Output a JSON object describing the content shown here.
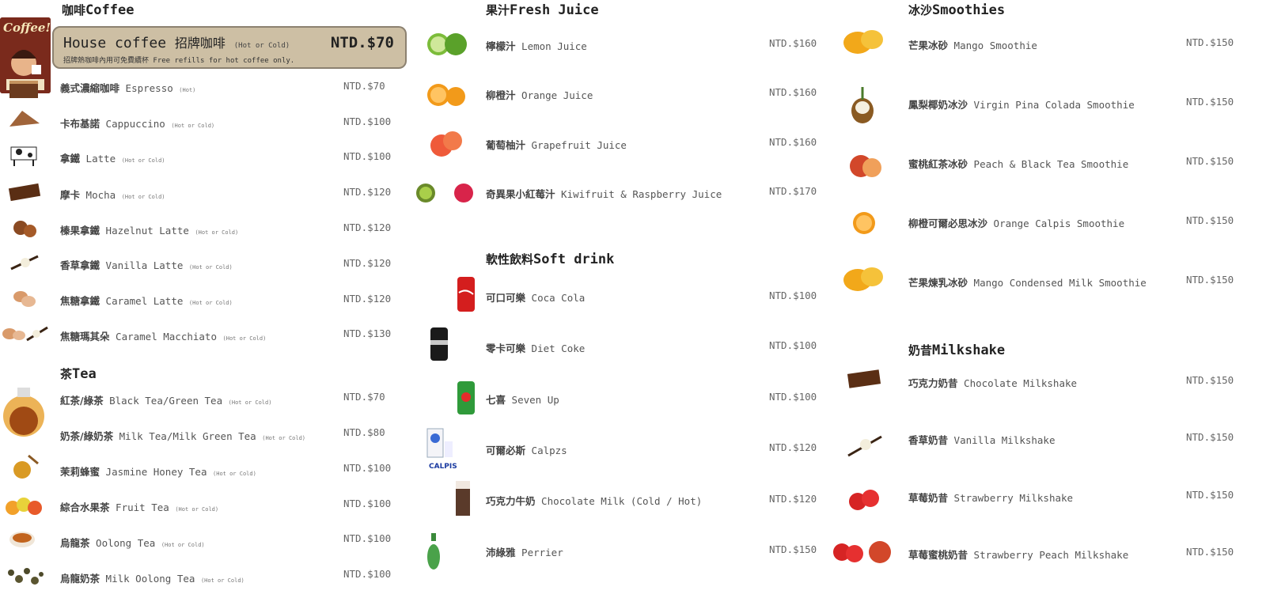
{
  "coffee": {
    "title_zh": "咖啡",
    "title_en": "Coffee",
    "house": {
      "name_en": "House coffee",
      "name_zh": "招牌咖啡",
      "note": "(Hot or Cold)",
      "price": "NTD.$70",
      "refill": "招牌熱咖啡內用可免費續杯 Free refills for hot coffee only."
    },
    "items": [
      {
        "zh": "義式濃縮咖啡",
        "en": "Espresso",
        "note": "(Hot)",
        "price": "NTD.$70"
      },
      {
        "zh": "卡布基諾",
        "en": "Cappuccino",
        "note": "(Hot or Cold)",
        "price": "NTD.$100"
      },
      {
        "zh": "拿鐵",
        "en": "Latte",
        "note": "(Hot or Cold)",
        "price": "NTD.$100"
      },
      {
        "zh": "摩卡",
        "en": "Mocha",
        "note": "(Hot or Cold)",
        "price": "NTD.$120"
      },
      {
        "zh": "榛果拿鐵",
        "en": " Hazelnut Latte",
        "note": "(Hot or Cold)",
        "price": "NTD.$120"
      },
      {
        "zh": "香草拿鐵",
        "en": "Vanilla Latte",
        "note": "(Hot or Cold)",
        "price": "NTD.$120"
      },
      {
        "zh": "焦糖拿鐵",
        "en": "Caramel Latte",
        "note": "(Hot or Cold)",
        "price": "NTD.$120"
      },
      {
        "zh": "焦糖瑪其朵",
        "en": "Caramel Macchiato",
        "note": "(Hot or Cold)",
        "price": "NTD.$130"
      }
    ]
  },
  "tea": {
    "title_zh": "茶",
    "title_en": "Tea",
    "items": [
      {
        "zh": "紅茶/綠茶",
        "en": "Black Tea/Green Tea",
        "note": "(Hot or Cold)",
        "price": "NTD.$70"
      },
      {
        "zh": "奶茶/綠奶茶",
        "en": "Milk Tea/Milk Green Tea",
        "note": "(Hot or Cold)",
        "price": "NTD.$80"
      },
      {
        "zh": "茉莉蜂蜜",
        "en": "Jasmine Honey Tea",
        "note": "(Hot or Cold)",
        "price": "NTD.$100"
      },
      {
        "zh": "綜合水果茶",
        "en": "Fruit Tea",
        "note": "(Hot or Cold)",
        "price": "NTD.$100"
      },
      {
        "zh": "烏龍茶",
        "en": "Oolong Tea",
        "note": "(Hot or Cold)",
        "price": "NTD.$100"
      },
      {
        "zh": "烏龍奶茶",
        "en": "Milk Oolong Tea",
        "note": "(Hot or Cold)",
        "price": "NTD.$100"
      }
    ]
  },
  "juice": {
    "title_zh": "果汁",
    "title_en": "Fresh Juice",
    "items": [
      {
        "zh": "檸檬汁",
        "en": "Lemon Juice",
        "price": "NTD.$160"
      },
      {
        "zh": "柳橙汁",
        "en": "Orange Juice",
        "price": "NTD.$160"
      },
      {
        "zh": "葡萄柚汁",
        "en": "Grapefruit Juice",
        "price": "NTD.$160"
      },
      {
        "zh": "奇異果小紅莓汁",
        "en": "Kiwifruit & Raspberry Juice",
        "price": "NTD.$170"
      }
    ]
  },
  "soft": {
    "title_zh": "軟性飲料",
    "title_en": "Soft drink",
    "items": [
      {
        "zh": "可口可樂",
        "en": "Coca Cola",
        "price": "NTD.$100"
      },
      {
        "zh": "零卡可樂",
        "en": "Diet Coke",
        "price": "NTD.$100"
      },
      {
        "zh": "七喜",
        "en": "Seven Up",
        "price": "NTD.$100"
      },
      {
        "zh": "可爾必斯",
        "en": "Calpzs",
        "price": "NTD.$120"
      },
      {
        "zh": "巧克力牛奶",
        "en": "Chocolate Milk (Cold / Hot)",
        "price": "NTD.$120"
      },
      {
        "zh": "沛綠雅",
        "en": "Perrier",
        "price": "NTD.$150"
      }
    ]
  },
  "smoothie": {
    "title_zh": "冰沙",
    "title_en": "Smoothies",
    "items": [
      {
        "zh": "芒果冰砂",
        "en": "Mango Smoothie",
        "price": "NTD.$150"
      },
      {
        "zh": "鳳梨椰奶冰沙",
        "en": "Virgin Pina Colada Smoothie",
        "price": "NTD.$150"
      },
      {
        "zh": "蜜桃紅茶冰砂",
        "en": "Peach & Black Tea Smoothie",
        "price": "NTD.$150"
      },
      {
        "zh": "柳橙可爾必思冰沙",
        "en": "Orange Calpis Smoothie",
        "price": "NTD.$150"
      },
      {
        "zh": "芒果煉乳冰砂",
        "en": "Mango Condensed Milk Smoothie",
        "price": "NTD.$150"
      }
    ]
  },
  "milkshake": {
    "title_zh": "奶昔",
    "title_en": "Milkshake",
    "items": [
      {
        "zh": "巧克力奶昔",
        "en": "Chocolate Milkshake",
        "price": "NTD.$150"
      },
      {
        "zh": "香草奶昔",
        "en": "Vanilla Milkshake",
        "price": "NTD.$150"
      },
      {
        "zh": "草莓奶昔",
        "en": "Strawberry Milkshake",
        "price": "NTD.$150"
      },
      {
        "zh": "草莓蜜桃奶昔",
        "en": "Strawberry Peach Milkshake",
        "price": "NTD.$150"
      }
    ]
  },
  "poster_text": "Coffee!",
  "calpis_label": "CALPIS",
  "colors": {
    "house_bg": "#cdbfa4",
    "house_border": "#8c8170",
    "text": "#555555",
    "heading": "#222222"
  }
}
